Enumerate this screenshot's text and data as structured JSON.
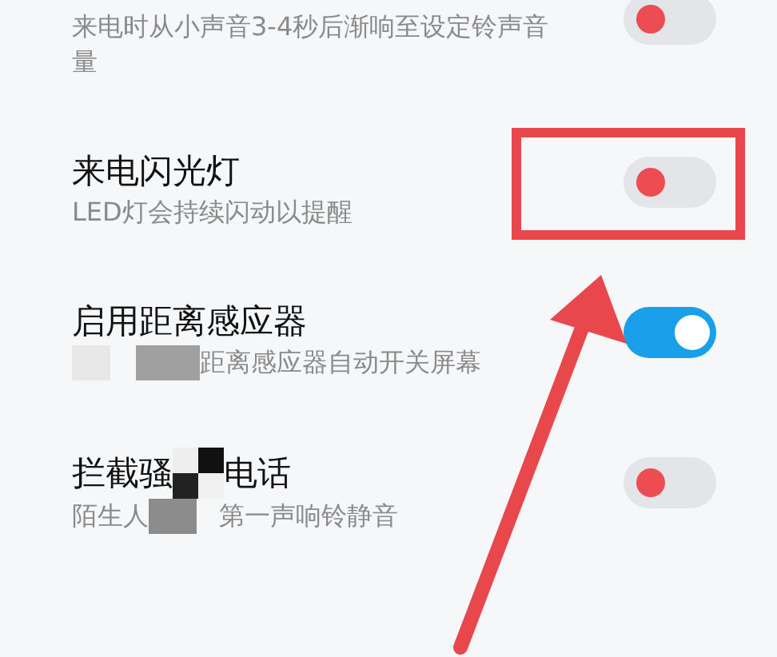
{
  "items": [
    {
      "subtitle": [
        {
          "kind": "text",
          "text": "来电时从小声音3-4秒后渐响至设定铃声音量"
        }
      ],
      "on": false,
      "highlighted": false
    },
    {
      "title": [
        {
          "kind": "text",
          "text": "来电闪光灯"
        }
      ],
      "subtitle": [
        {
          "kind": "text",
          "text": "LED灯会持续闪动以提醒"
        }
      ],
      "on": false,
      "highlighted": true
    },
    {
      "title": [
        {
          "kind": "text",
          "text": "启用距离感应器"
        }
      ],
      "subtitle": [
        {
          "kind": "mosaic"
        },
        {
          "kind": "text",
          "text": "距离感应器自动开关屏幕"
        }
      ],
      "on": true,
      "highlighted": false
    },
    {
      "title": [
        {
          "kind": "text",
          "text": "拦截骚"
        },
        {
          "kind": "mosaic"
        },
        {
          "kind": "text",
          "text": "电话"
        }
      ],
      "subtitle": [
        {
          "kind": "text",
          "text": "陌生人"
        },
        {
          "kind": "mosaic"
        },
        {
          "kind": "text",
          "text": "第一声响铃静音"
        }
      ],
      "on": false,
      "highlighted": false
    }
  ]
}
